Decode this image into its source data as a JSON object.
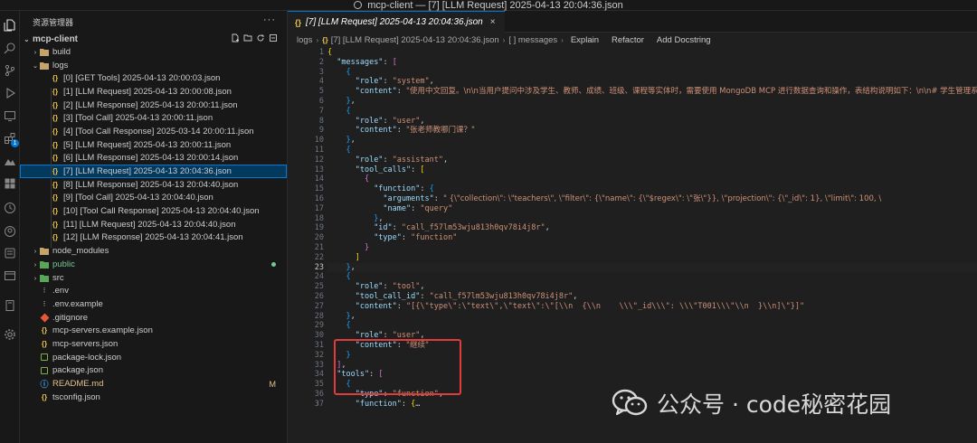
{
  "window": {
    "title": "mcp-client — [7] [LLM Request] 2025-04-13 20:04:36.json"
  },
  "activity_bar": {
    "icons": [
      "explorer-icon",
      "search-icon",
      "source-control-icon",
      "run-debug-icon",
      "remote-explorer-icon",
      "extensions-icon",
      "database-icon",
      "grid-icon",
      "timeline-icon",
      "accounts-icon",
      "docker-icon",
      "terminal-icon",
      "book-icon",
      "settings-icon"
    ],
    "extensions_badge": "1"
  },
  "sidebar": {
    "header": "资源管理器",
    "more": "···",
    "root": "mcp-client",
    "items": [
      {
        "label": "build",
        "type": "folder",
        "indent": 1,
        "collapsed": true
      },
      {
        "label": "logs",
        "type": "folder",
        "indent": 1,
        "collapsed": false
      },
      {
        "label": "[0] [GET Tools] 2025-04-13 20:00:03.json",
        "type": "json",
        "indent": 2
      },
      {
        "label": "[1] [LLM Request] 2025-04-13 20:00:08.json",
        "type": "json",
        "indent": 2
      },
      {
        "label": "[2] [LLM Response] 2025-04-13 20:00:11.json",
        "type": "json",
        "indent": 2
      },
      {
        "label": "[3] [Tool Call] 2025-04-13 20:00:11.json",
        "type": "json",
        "indent": 2
      },
      {
        "label": "[4] [Tool Call Response] 2025-03-14 20:00:11.json",
        "type": "json",
        "indent": 2
      },
      {
        "label": "[5] [LLM Request] 2025-04-13 20:00:11.json",
        "type": "json",
        "indent": 2
      },
      {
        "label": "[6] [LLM Response] 2025-04-13 20:00:14.json",
        "type": "json",
        "indent": 2
      },
      {
        "label": "[7] [LLM Request] 2025-04-13 20:04:36.json",
        "type": "json",
        "indent": 2,
        "selected": true
      },
      {
        "label": "[8] [LLM Response] 2025-04-13 20:04:40.json",
        "type": "json",
        "indent": 2
      },
      {
        "label": "[9] [Tool Call] 2025-04-13 20:04:40.json",
        "type": "json",
        "indent": 2
      },
      {
        "label": "[10] [Tool Call Response] 2025-04-13 20:04:40.json",
        "type": "json",
        "indent": 2
      },
      {
        "label": "[11] [LLM Request] 2025-04-13 20:04:40.json",
        "type": "json",
        "indent": 2
      },
      {
        "label": "[12] [LLM Response] 2025-04-13 20:04:41.json",
        "type": "json",
        "indent": 2
      },
      {
        "label": "node_modules",
        "type": "folder",
        "indent": 1,
        "collapsed": true
      },
      {
        "label": "public",
        "type": "folder-green",
        "indent": 1,
        "collapsed": true,
        "dot": true
      },
      {
        "label": "src",
        "type": "folder-green",
        "indent": 1,
        "collapsed": true
      },
      {
        "label": ".env",
        "type": "env",
        "indent": 1
      },
      {
        "label": ".env.example",
        "type": "env",
        "indent": 1
      },
      {
        "label": ".gitignore",
        "type": "git",
        "indent": 1
      },
      {
        "label": "mcp-servers.example.json",
        "type": "json",
        "indent": 1
      },
      {
        "label": "mcp-servers.json",
        "type": "json",
        "indent": 1
      },
      {
        "label": "package-lock.json",
        "type": "npm",
        "indent": 1
      },
      {
        "label": "package.json",
        "type": "npm",
        "indent": 1
      },
      {
        "label": "README.md",
        "type": "md",
        "indent": 1,
        "status": "M"
      },
      {
        "label": "tsconfig.json",
        "type": "json",
        "indent": 1
      }
    ]
  },
  "editor": {
    "tab": {
      "label": "[7] [LLM Request] 2025-04-13 20:04:36.json",
      "close": "×"
    },
    "breadcrumb": {
      "folder": "logs",
      "file": "[7] [LLM Request] 2025-04-13 20:04:36.json",
      "symbol": "[ ] messages",
      "actions": [
        "Explain",
        "Refactor",
        "Add Docstring"
      ]
    },
    "active_line": 23,
    "lines": [
      [
        [
          "{",
          "b1"
        ]
      ],
      [
        [
          "  ",
          "p"
        ],
        [
          "\"messages\"",
          "k"
        ],
        [
          ": ",
          "p"
        ],
        [
          "[",
          "b2"
        ]
      ],
      [
        [
          "    ",
          "p"
        ],
        [
          "{",
          "b3"
        ]
      ],
      [
        [
          "      ",
          "p"
        ],
        [
          "\"role\"",
          "k"
        ],
        [
          ": ",
          "p"
        ],
        [
          "\"system\"",
          "s"
        ],
        [
          ",",
          "p"
        ]
      ],
      [
        [
          "      ",
          "p"
        ],
        [
          "\"content\"",
          "k"
        ],
        [
          ": ",
          "p"
        ],
        [
          "\"使用中文回复。\\n\\n当用户提问中涉及学生、教师、成绩、班级、课程等实体时，需要使用 MongoDB MCP 进行数据查询和操作，表结构说明如下：\\n\\n# 学生管理系统数据库表",
          "s"
        ]
      ],
      [
        [
          "    ",
          "p"
        ],
        [
          "}",
          "b3"
        ],
        [
          ",",
          "p"
        ]
      ],
      [
        [
          "    ",
          "p"
        ],
        [
          "{",
          "b3"
        ]
      ],
      [
        [
          "      ",
          "p"
        ],
        [
          "\"role\"",
          "k"
        ],
        [
          ": ",
          "p"
        ],
        [
          "\"user\"",
          "s"
        ],
        [
          ",",
          "p"
        ]
      ],
      [
        [
          "      ",
          "p"
        ],
        [
          "\"content\"",
          "k"
        ],
        [
          ": ",
          "p"
        ],
        [
          "\"张老师教哪门课？\"",
          "s"
        ]
      ],
      [
        [
          "    ",
          "p"
        ],
        [
          "}",
          "b3"
        ],
        [
          ",",
          "p"
        ]
      ],
      [
        [
          "    ",
          "p"
        ],
        [
          "{",
          "b3"
        ]
      ],
      [
        [
          "      ",
          "p"
        ],
        [
          "\"role\"",
          "k"
        ],
        [
          ": ",
          "p"
        ],
        [
          "\"assistant\"",
          "s"
        ],
        [
          ",",
          "p"
        ]
      ],
      [
        [
          "      ",
          "p"
        ],
        [
          "\"tool_calls\"",
          "k"
        ],
        [
          ": ",
          "p"
        ],
        [
          "[",
          "b1"
        ]
      ],
      [
        [
          "        ",
          "p"
        ],
        [
          "{",
          "b2"
        ]
      ],
      [
        [
          "          ",
          "p"
        ],
        [
          "\"function\"",
          "k"
        ],
        [
          ": ",
          "p"
        ],
        [
          "{",
          "b3"
        ]
      ],
      [
        [
          "            ",
          "p"
        ],
        [
          "\"arguments\"",
          "k"
        ],
        [
          ": ",
          "p"
        ],
        [
          "\" {\\\"collection\\\": \\\"teachers\\\", \\\"filter\\\": {\\\"name\\\": {\\\"$regex\\\": \\\"张\\\"}}, \\\"projection\\\": {\\\"_id\\\": 1}, \\\"limit\\\": 100, \\",
          "s"
        ]
      ],
      [
        [
          "            ",
          "p"
        ],
        [
          "\"name\"",
          "k"
        ],
        [
          ": ",
          "p"
        ],
        [
          "\"query\"",
          "s"
        ]
      ],
      [
        [
          "          ",
          "p"
        ],
        [
          "}",
          "b3"
        ],
        [
          ",",
          "p"
        ]
      ],
      [
        [
          "          ",
          "p"
        ],
        [
          "\"id\"",
          "k"
        ],
        [
          ": ",
          "p"
        ],
        [
          "\"call_f57lm53wju813h0qv78i4j8r\"",
          "s"
        ],
        [
          ",",
          "p"
        ]
      ],
      [
        [
          "          ",
          "p"
        ],
        [
          "\"type\"",
          "k"
        ],
        [
          ": ",
          "p"
        ],
        [
          "\"function\"",
          "s"
        ]
      ],
      [
        [
          "        ",
          "p"
        ],
        [
          "}",
          "b2"
        ]
      ],
      [
        [
          "      ",
          "p"
        ],
        [
          "]",
          "b1"
        ]
      ],
      [
        [
          "    ",
          "p"
        ],
        [
          "}",
          "b3"
        ],
        [
          ",",
          "p"
        ]
      ],
      [
        [
          "    ",
          "p"
        ],
        [
          "{",
          "b3"
        ]
      ],
      [
        [
          "      ",
          "p"
        ],
        [
          "\"role\"",
          "k"
        ],
        [
          ": ",
          "p"
        ],
        [
          "\"tool\"",
          "s"
        ],
        [
          ",",
          "p"
        ]
      ],
      [
        [
          "      ",
          "p"
        ],
        [
          "\"tool_call_id\"",
          "k"
        ],
        [
          ": ",
          "p"
        ],
        [
          "\"call_f57lm53wju813h0qv78i4j8r\"",
          "s"
        ],
        [
          ",",
          "p"
        ]
      ],
      [
        [
          "      ",
          "p"
        ],
        [
          "\"content\"",
          "k"
        ],
        [
          ": ",
          "p"
        ],
        [
          "\"[{\\\"type\\\":\\\"text\\\",\\\"text\\\":\\\"[\\\\n  {\\\\n    \\\\\\\"_id\\\\\\\": \\\\\\\"T001\\\\\\\"\\\\n  }\\\\n]\\\"}]\"",
          "s"
        ]
      ],
      [
        [
          "    ",
          "p"
        ],
        [
          "}",
          "b3"
        ],
        [
          ",",
          "p"
        ]
      ],
      [
        [
          "    ",
          "p"
        ],
        [
          "{",
          "b3"
        ]
      ],
      [
        [
          "      ",
          "p"
        ],
        [
          "\"role\"",
          "k"
        ],
        [
          ": ",
          "p"
        ],
        [
          "\"user\"",
          "s"
        ],
        [
          ",",
          "p"
        ]
      ],
      [
        [
          "      ",
          "p"
        ],
        [
          "\"content\"",
          "k"
        ],
        [
          ": ",
          "p"
        ],
        [
          "\"继续\"",
          "s"
        ]
      ],
      [
        [
          "    ",
          "p"
        ],
        [
          "}",
          "b3"
        ]
      ],
      [
        [
          "  ",
          "p"
        ],
        [
          "]",
          "b2"
        ],
        [
          ",",
          "p"
        ]
      ],
      [
        [
          "  ",
          "p"
        ],
        [
          "\"tools\"",
          "k"
        ],
        [
          ": ",
          "p"
        ],
        [
          "[",
          "b2"
        ]
      ],
      [
        [
          "    ",
          "p"
        ],
        [
          "{",
          "b3"
        ]
      ],
      [
        [
          "      ",
          "p"
        ],
        [
          "\"type\"",
          "k"
        ],
        [
          ": ",
          "p"
        ],
        [
          "\"function\"",
          "s"
        ],
        [
          ",",
          "p"
        ]
      ],
      [
        [
          "      ",
          "p"
        ],
        [
          "\"function\"",
          "k"
        ],
        [
          ": ",
          "p"
        ],
        [
          "{",
          "b1"
        ],
        [
          "…",
          "p"
        ]
      ]
    ]
  },
  "watermark": {
    "text": "公众号 · code秘密花园"
  },
  "colors": {
    "accent": "#0078d4",
    "highlight_box": "#e03c3c",
    "json_icon": "#e8c14d"
  }
}
